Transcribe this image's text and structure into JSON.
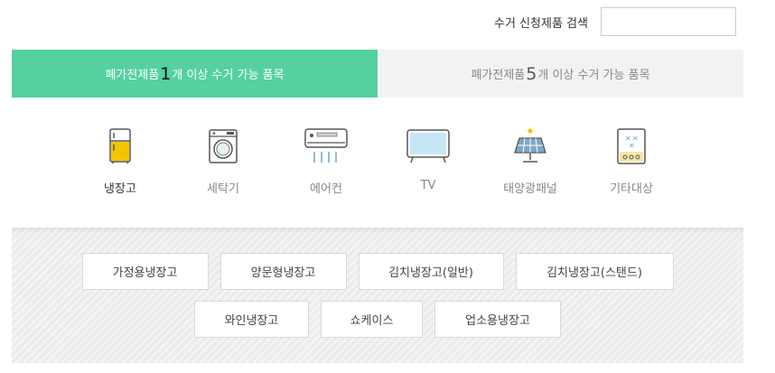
{
  "search": {
    "label": "수거 신청제품 검색",
    "value": ""
  },
  "tabs": [
    {
      "pre": "폐가전제품 ",
      "num": "1",
      "post": "개 이상 수거 가능 품목"
    },
    {
      "pre": "폐가전제품 ",
      "num": "5",
      "post": "개 이상 수거 가능 품목"
    }
  ],
  "categories": [
    {
      "label": "냉장고",
      "icon": "refrigerator-icon"
    },
    {
      "label": "세탁기",
      "icon": "washing-machine-icon"
    },
    {
      "label": "에어컨",
      "icon": "air-conditioner-icon"
    },
    {
      "label": "TV",
      "icon": "tv-icon"
    },
    {
      "label": "태양광패널",
      "icon": "solar-panel-icon"
    },
    {
      "label": "기타대상",
      "icon": "other-appliance-icon"
    }
  ],
  "subcategories": [
    "가정용냉장고",
    "양문형냉장고",
    "김치냉장고(일반)",
    "김치냉장고(스탠드)",
    "와인냉장고",
    "쇼케이스",
    "업소용냉장고"
  ],
  "colors": {
    "accent": "#55d1a0",
    "fridge_accent": "#f5c400"
  }
}
